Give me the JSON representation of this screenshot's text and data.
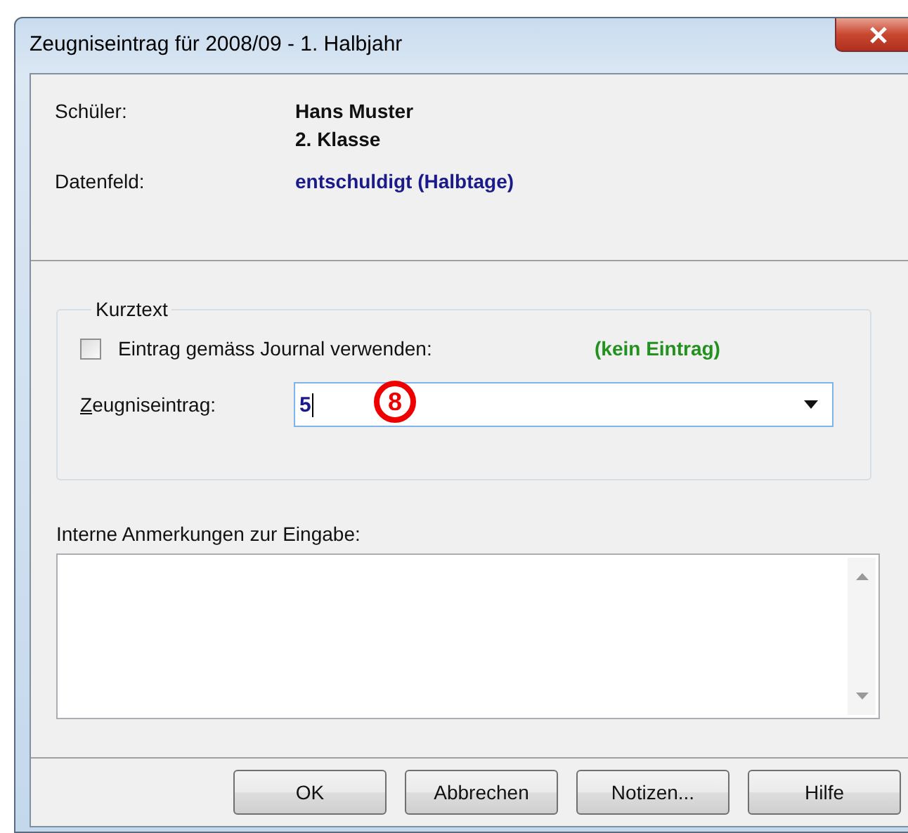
{
  "window": {
    "title": "Zeugniseintrag für 2008/09 - 1. Halbjahr"
  },
  "info": [
    {
      "label": "Schüler:",
      "lines": [
        "Hans Muster",
        "2. Klasse"
      ],
      "kind": "plain"
    },
    {
      "label": "Datenfeld:",
      "lines": [
        "entschuldigt (Halbtage)"
      ],
      "kind": "field"
    }
  ],
  "kurztext": {
    "legend": "Kurztext",
    "checkbox": {
      "label": "Eintrag gemäss Journal verwenden:",
      "checked": false
    },
    "journal_value": "(kein Eintrag)",
    "entry": {
      "label": "Zeugniseintrag:",
      "value": "5"
    },
    "annotation": "8"
  },
  "notes": {
    "label": "Interne Anmerkungen zur Eingabe:"
  },
  "buttons": [
    "OK",
    "Abbrechen",
    "Notizen...",
    "Hilfe"
  ]
}
